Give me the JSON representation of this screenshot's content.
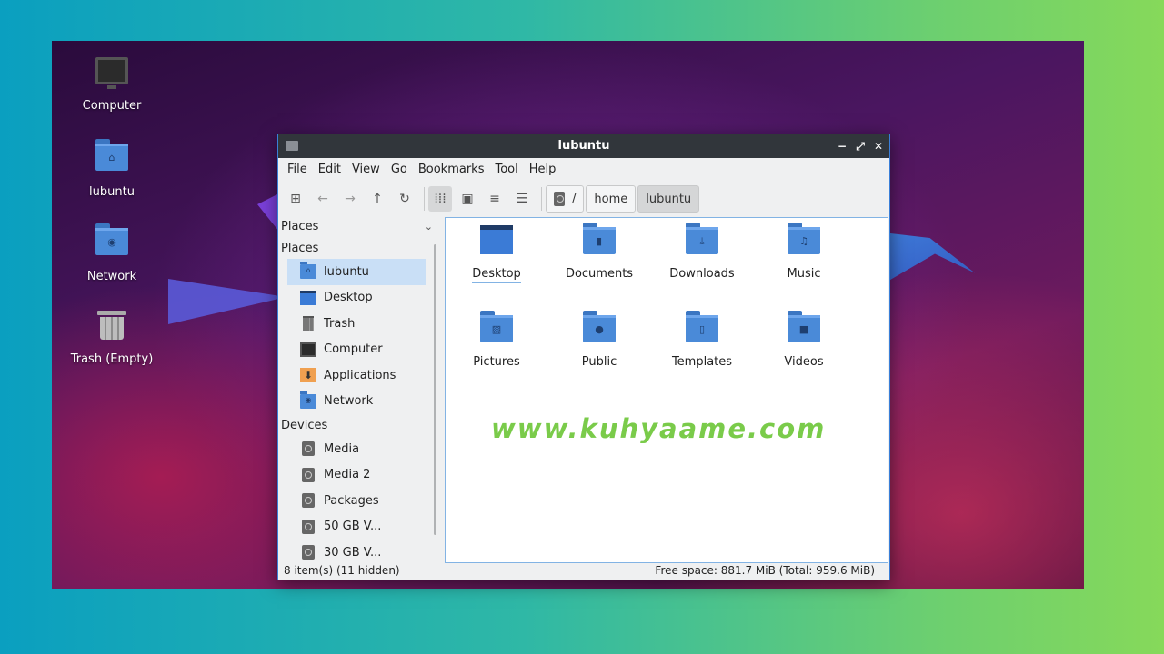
{
  "desktop": {
    "icons": [
      {
        "label": "Computer",
        "icon": "computer-icon"
      },
      {
        "label": "lubuntu",
        "icon": "home-folder-icon"
      },
      {
        "label": "Network",
        "icon": "network-folder-icon"
      },
      {
        "label": "Trash (Empty)",
        "icon": "trash-icon"
      }
    ]
  },
  "window": {
    "title": "lubuntu",
    "controls": {
      "minimize": "−",
      "maximize": "⤢",
      "close": "✕"
    },
    "menu": [
      "File",
      "Edit",
      "View",
      "Go",
      "Bookmarks",
      "Tool",
      "Help"
    ],
    "toolbar": {
      "icons": [
        "new-tab-icon",
        "back-arrow-icon",
        "forward-arrow-icon",
        "up-arrow-icon",
        "reload-icon",
        "icon-view-icon",
        "thumbnail-view-icon",
        "compact-view-icon",
        "detailed-list-view-icon"
      ],
      "path": [
        {
          "label": "/",
          "icon": "disk-icon"
        },
        {
          "label": "home"
        },
        {
          "label": "lubuntu"
        }
      ]
    },
    "sidebar": {
      "dropdown_label": "Places",
      "places_header": "Places",
      "places": [
        {
          "label": "lubuntu",
          "icon": "home-folder-icon"
        },
        {
          "label": "Desktop",
          "icon": "desktop-icon"
        },
        {
          "label": "Trash",
          "icon": "trash-icon"
        },
        {
          "label": "Computer",
          "icon": "computer-icon"
        },
        {
          "label": "Applications",
          "icon": "applications-icon"
        },
        {
          "label": "Network",
          "icon": "network-folder-icon"
        }
      ],
      "devices_header": "Devices",
      "devices": [
        {
          "label": "Media",
          "icon": "drive-icon"
        },
        {
          "label": "Media 2",
          "icon": "drive-icon"
        },
        {
          "label": "Packages",
          "icon": "drive-icon"
        },
        {
          "label": "50 GB V...",
          "icon": "drive-icon"
        },
        {
          "label": "30 GB V...",
          "icon": "drive-icon"
        }
      ]
    },
    "files": [
      {
        "label": "Desktop",
        "icon": "desktop-folder-icon"
      },
      {
        "label": "Documents",
        "icon": "documents-folder-icon"
      },
      {
        "label": "Downloads",
        "icon": "downloads-folder-icon"
      },
      {
        "label": "Music",
        "icon": "music-folder-icon"
      },
      {
        "label": "Pictures",
        "icon": "pictures-folder-icon"
      },
      {
        "label": "Public",
        "icon": "public-folder-icon"
      },
      {
        "label": "Templates",
        "icon": "templates-folder-icon"
      },
      {
        "label": "Videos",
        "icon": "videos-folder-icon"
      }
    ],
    "watermark": "www.kuhyaame.com",
    "status": {
      "items": "8 item(s) (11 hidden)",
      "free_space": "Free space: 881.7 MiB (Total: 959.6 MiB)"
    }
  },
  "colors": {
    "accent": "#3a7fd8",
    "folder": "#4a8ad8",
    "watermark": "#7acb4a",
    "titlebar": "#31363b"
  }
}
